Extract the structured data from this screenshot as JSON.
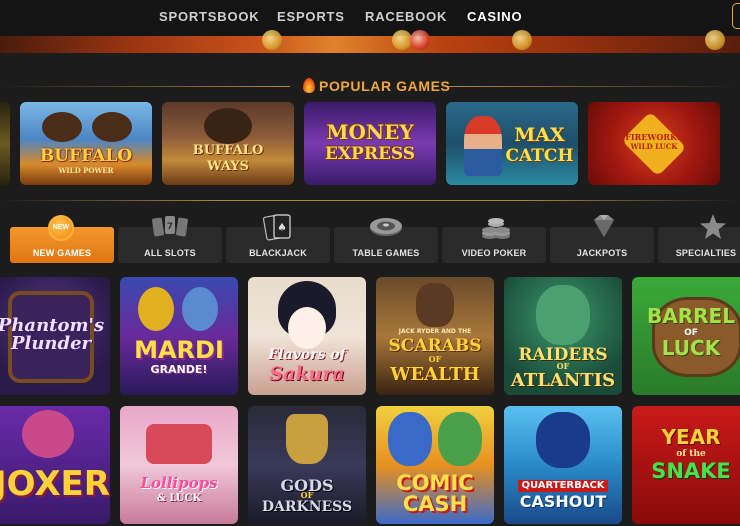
{
  "nav": {
    "items": [
      {
        "label": "SPORTSBOOK",
        "active": false
      },
      {
        "label": "ESPORTS",
        "active": false
      },
      {
        "label": "RACEBOOK",
        "active": false
      },
      {
        "label": "CASINO",
        "active": true
      }
    ]
  },
  "popular": {
    "title": "POPULAR GAMES",
    "icon": "flame-icon",
    "games": [
      {
        "title": "BUFFALO",
        "subtitle": "WILD POWER"
      },
      {
        "title": "BUFFALO",
        "subtitle": "WAYS"
      },
      {
        "title": "MONEY",
        "subtitle": "EXPRESS"
      },
      {
        "title": "MAX",
        "subtitle": "CATCH"
      },
      {
        "title": "FIREWORKS",
        "subtitle": "WILD LUCK"
      }
    ]
  },
  "categories": [
    {
      "label": "NEW GAMES",
      "icon": "new-badge-icon",
      "badge": "NEW",
      "active": true
    },
    {
      "label": "ALL SLOTS",
      "icon": "slot-reels-icon",
      "active": false
    },
    {
      "label": "BLACKJACK",
      "icon": "playing-cards-icon",
      "active": false
    },
    {
      "label": "TABLE GAMES",
      "icon": "roulette-wheel-icon",
      "active": false
    },
    {
      "label": "VIDEO POKER",
      "icon": "chip-stack-icon",
      "active": false
    },
    {
      "label": "JACKPOTS",
      "icon": "diamond-icon",
      "active": false
    },
    {
      "label": "SPECIALTIES",
      "icon": "star-icon",
      "active": false
    }
  ],
  "games": [
    {
      "line1": "Phantom's",
      "line2": "Plunder"
    },
    {
      "line1": "MARDI",
      "line2": "GRANDE!"
    },
    {
      "line1": "Flavors of",
      "line2": "Sakura"
    },
    {
      "line1": "JACK RYDER AND THE",
      "line2": "SCARABS",
      "line3": "OF",
      "line4": "WEALTH"
    },
    {
      "line1": "RAIDERS",
      "line2": "OF",
      "line3": "ATLANTIS"
    },
    {
      "line1": "BARREL",
      "line2": "OF",
      "line3": "LUCK"
    },
    {
      "line1": "JOXER"
    },
    {
      "line1": "Lollipops",
      "line2": "& LUCK"
    },
    {
      "line1": "GODS",
      "line2": "OF",
      "line3": "DARKNESS"
    },
    {
      "line1": "COMIC",
      "line2": "CASH"
    },
    {
      "line1": "QUARTERBACK",
      "line2": "CASHOUT"
    },
    {
      "line1": "YEAR",
      "line2": "of the",
      "line3": "SNAKE"
    }
  ],
  "colors": {
    "accent": "#f0a83c",
    "active_tab": "#f08a1c",
    "background": "#1c1c1c"
  }
}
